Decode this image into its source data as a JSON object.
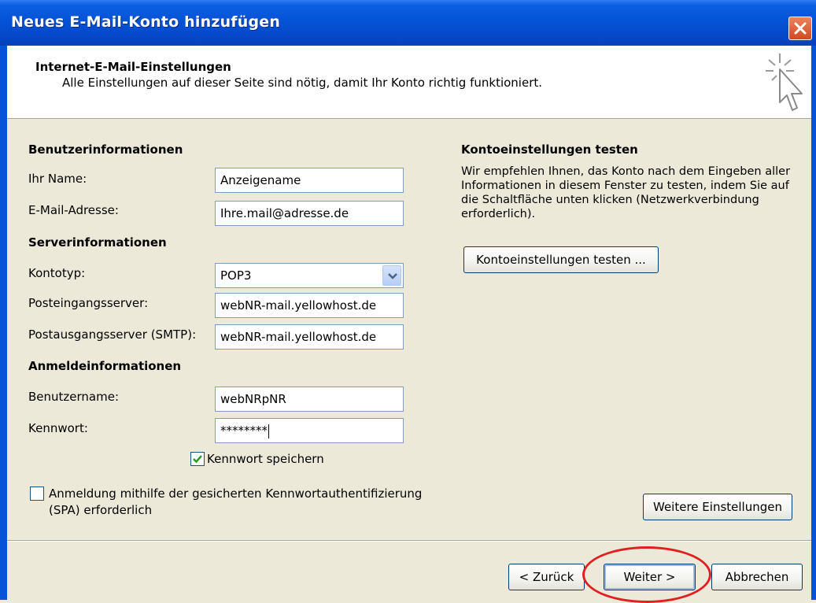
{
  "window": {
    "title": "Neues E-Mail-Konto hinzufügen"
  },
  "header": {
    "title": "Internet-E-Mail-Einstellungen",
    "subtitle": "Alle Einstellungen auf dieser Seite sind nötig, damit Ihr Konto richtig funktioniert."
  },
  "user_info": {
    "heading": "Benutzerinformationen",
    "name_label": "Ihr Name:",
    "name_value": "Anzeigename",
    "email_label": "E-Mail-Adresse:",
    "email_value": "Ihre.mail@adresse.de"
  },
  "server_info": {
    "heading": "Serverinformationen",
    "account_type_label": "Kontotyp:",
    "account_type_value": "POP3",
    "incoming_label": "Posteingangsserver:",
    "incoming_value": "webNR-mail.yellowhost.de",
    "outgoing_label": "Postausgangsserver (SMTP):",
    "outgoing_value": "webNR-mail.yellowhost.de"
  },
  "login_info": {
    "heading": "Anmeldeinformationen",
    "username_label": "Benutzername:",
    "username_value": "webNRpNR",
    "password_label": "Kennwort:",
    "password_value": "********",
    "save_password_label": "Kennwort speichern",
    "save_password_checked": true,
    "spa_label_line1": "Anmeldung mithilfe der gesicherten Kennwortauthentifizierung",
    "spa_label_line2": "(SPA) erforderlich",
    "spa_checked": false
  },
  "test_settings": {
    "heading": "Kontoeinstellungen testen",
    "description": "Wir empfehlen Ihnen, das Konto nach dem Eingeben aller Informationen in diesem Fenster zu testen, indem Sie auf die Schaltfläche unten klicken (Netzwerkverbindung erforderlich).",
    "test_button": "Kontoeinstellungen testen ...",
    "more_settings_button": "Weitere Einstellungen"
  },
  "footer": {
    "back_button": "< Zurück",
    "next_button": "Weiter >",
    "cancel_button": "Abbrechen"
  },
  "colors": {
    "titlebar": "#0553D7",
    "dialog_bg": "#ECE9D8",
    "highlight_ellipse": "#E02020",
    "checkmark": "#21A121"
  },
  "icons": {
    "close": "close-icon",
    "header": "click-cursor-icon",
    "dropdown": "chevron-down-icon",
    "check": "checkmark-icon"
  }
}
